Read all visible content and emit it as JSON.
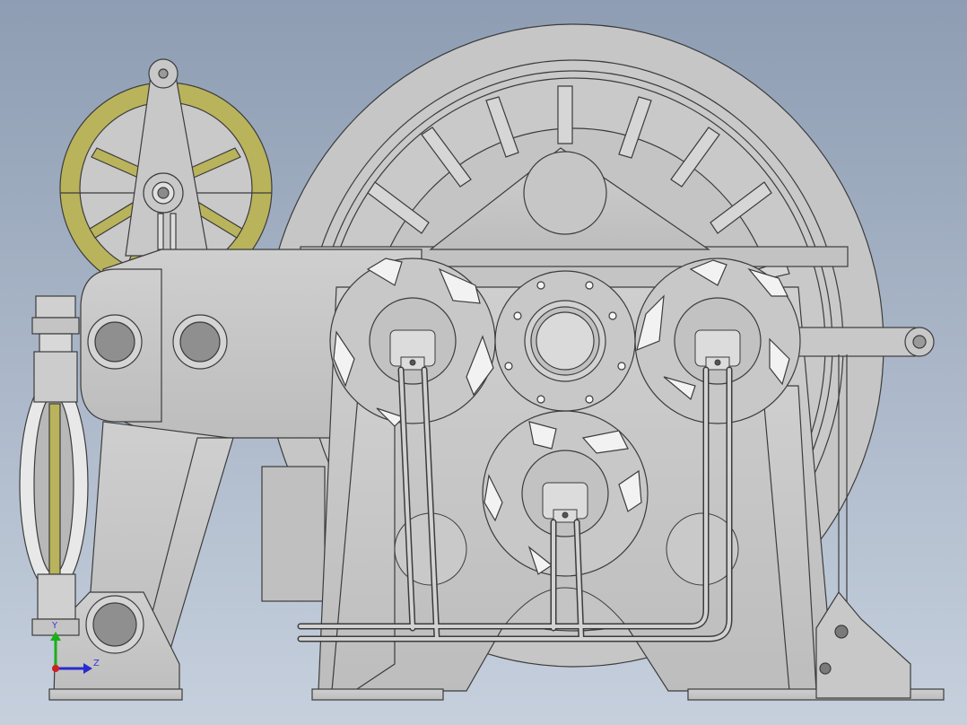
{
  "viewport": {
    "background_top": "#8e9db3",
    "background_bottom": "#c6d0dd"
  },
  "model": {
    "body_color": "#c8c8c8",
    "outline_color": "#3c3c3c",
    "sheave_color": "#b9b35c",
    "pipe_color": "#d2d2d2"
  },
  "triad": {
    "y_label": "Y",
    "z_label": "Z",
    "y_color": "#18b018",
    "z_color": "#2a2ad0",
    "x_color": "#d02020"
  }
}
